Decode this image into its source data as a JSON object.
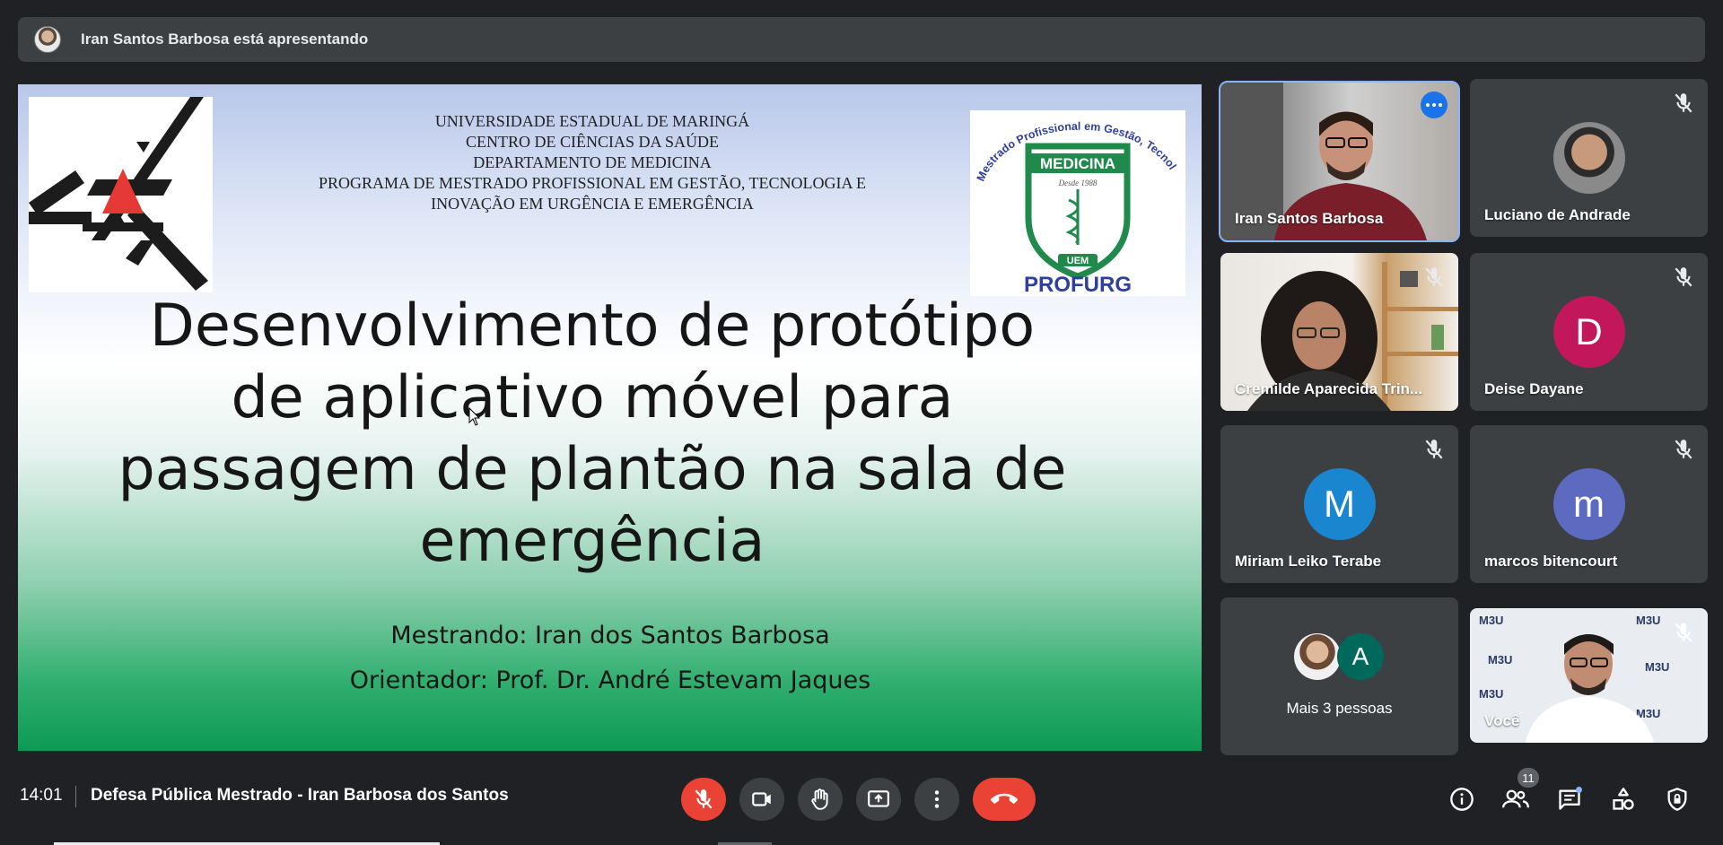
{
  "banner": {
    "text": "Iran Santos Barbosa está apresentando"
  },
  "slide": {
    "header_lines": [
      "UNIVERSIDADE ESTADUAL DE MARINGÁ",
      "CENTRO DE CIÊNCIAS DA SAÚDE",
      "DEPARTAMENTO DE MEDICINA",
      "PROGRAMA DE MESTRADO PROFISSIONAL EM GESTÃO, TECNOLOGIA E",
      "INOVAÇÃO EM URGÊNCIA E EMERGÊNCIA"
    ],
    "title_lines": [
      "Desenvolvimento de protótipo",
      "de aplicativo móvel para",
      "passagem de plantão na sala de",
      "emergência"
    ],
    "student": "Mestrando: Iran dos Santos Barbosa",
    "advisor": "Orientador: Prof. Dr. André Estevam Jaques",
    "logo": {
      "arc_text": "Mestrado Profissional em Gestão, Tecnologia e Inovação em Urgência e Emergência",
      "shield_title": "MEDICINA",
      "shield_year": "Desde 1988",
      "shield_uem": "UEM",
      "program": "PROFURG"
    }
  },
  "participants": [
    {
      "name": "Iran Santos Barbosa",
      "type": "video",
      "active": true
    },
    {
      "name": "Luciano de Andrade",
      "type": "photo",
      "muted": true
    },
    {
      "name": "Cremilde Aparecida Trin...",
      "type": "video",
      "muted": true
    },
    {
      "name": "Deise Dayane",
      "type": "initial",
      "initial": "D",
      "color": "#c2185b",
      "muted": true
    },
    {
      "name": "Miriam Leiko Terabe",
      "type": "initial",
      "initial": "M",
      "color": "#1a86d0",
      "muted": true
    },
    {
      "name": "marcos bitencourt",
      "type": "initial",
      "initial": "m",
      "color": "#5c6bc0",
      "muted": true
    },
    {
      "name": "Mais 3 pessoas",
      "type": "group",
      "group_initial": "A",
      "group_color": "#00695c"
    },
    {
      "name": "Você",
      "type": "video",
      "muted": true,
      "backdrop_text": "M3U"
    }
  ],
  "bottom_bar": {
    "time": "14:01",
    "meeting_title": "Defesa Pública Mestrado - Iran Barbosa dos Santos",
    "participant_count": "11",
    "colors": {
      "end_call": "#ea4335",
      "mic_off": "#ea4335",
      "control_bg": "#3c4043"
    }
  },
  "icons": [
    "mic-off-icon",
    "camera-icon",
    "raise-hand-icon",
    "present-icon",
    "more-options-icon",
    "end-call-icon",
    "info-icon",
    "people-icon",
    "chat-icon",
    "activities-icon",
    "host-controls-icon"
  ]
}
